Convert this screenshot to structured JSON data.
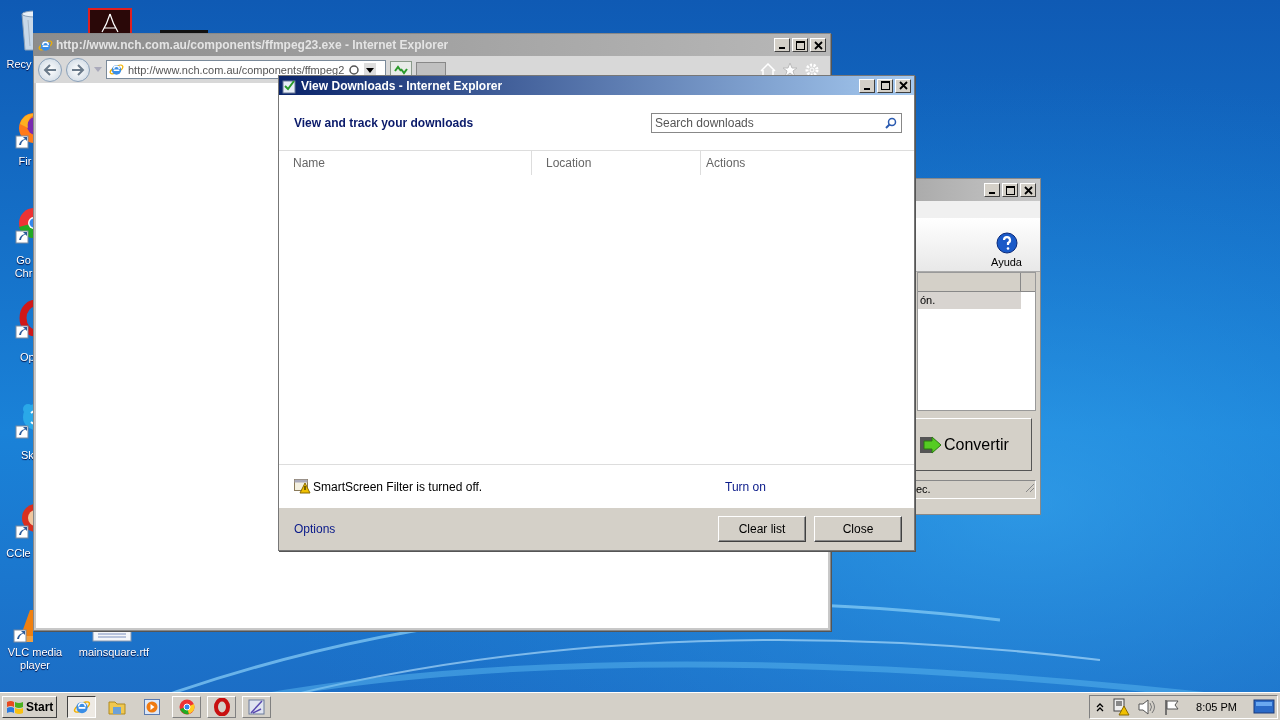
{
  "desktop_icons": [
    {
      "kind": "recycle",
      "label": "Recy"
    },
    {
      "kind": "pdf"
    },
    {
      "kind": "dark"
    },
    {
      "kind": "firefox",
      "label": "Fir"
    },
    {
      "kind": "chrome",
      "label": "Go Chr"
    },
    {
      "kind": "opera",
      "label": "Op"
    },
    {
      "kind": "skype",
      "label": "Sk"
    },
    {
      "kind": "ccleaner",
      "label": "CCle"
    },
    {
      "kind": "vlc",
      "label": "VLC media player"
    },
    {
      "kind": "document",
      "label": "mainsquare.rtf"
    }
  ],
  "browser_window": {
    "title": "http://www.nch.com.au/components/ffmpeg23.exe - Internet Explorer",
    "address": "http://www.nch.com.au/components/ffmpeg2"
  },
  "background_window": {
    "toolbar_button": "Ayuda",
    "list_row": "ón.",
    "convert_button": "Convertir",
    "status": "ec."
  },
  "downloads_dialog": {
    "title": "View Downloads - Internet Explorer",
    "heading": "View and track your downloads",
    "search": {
      "placeholder": "Search downloads"
    },
    "columns": [
      "Name",
      "Location",
      "Actions"
    ],
    "smartscreen": {
      "message": "SmartScreen Filter is turned off.",
      "link": "Turn on"
    },
    "options_link": "Options",
    "buttons": [
      "Clear list",
      "Close"
    ]
  },
  "taskbar": {
    "start": "Start",
    "apps": [
      {
        "kind": "ie",
        "selected": true
      },
      {
        "kind": "folder",
        "selected": false
      },
      {
        "kind": "media",
        "selected": false
      },
      {
        "kind": "chrome",
        "selected": false
      },
      {
        "kind": "opera",
        "selected": false
      },
      {
        "kind": "paint",
        "selected": false
      }
    ],
    "clock": "8:05 PM"
  }
}
